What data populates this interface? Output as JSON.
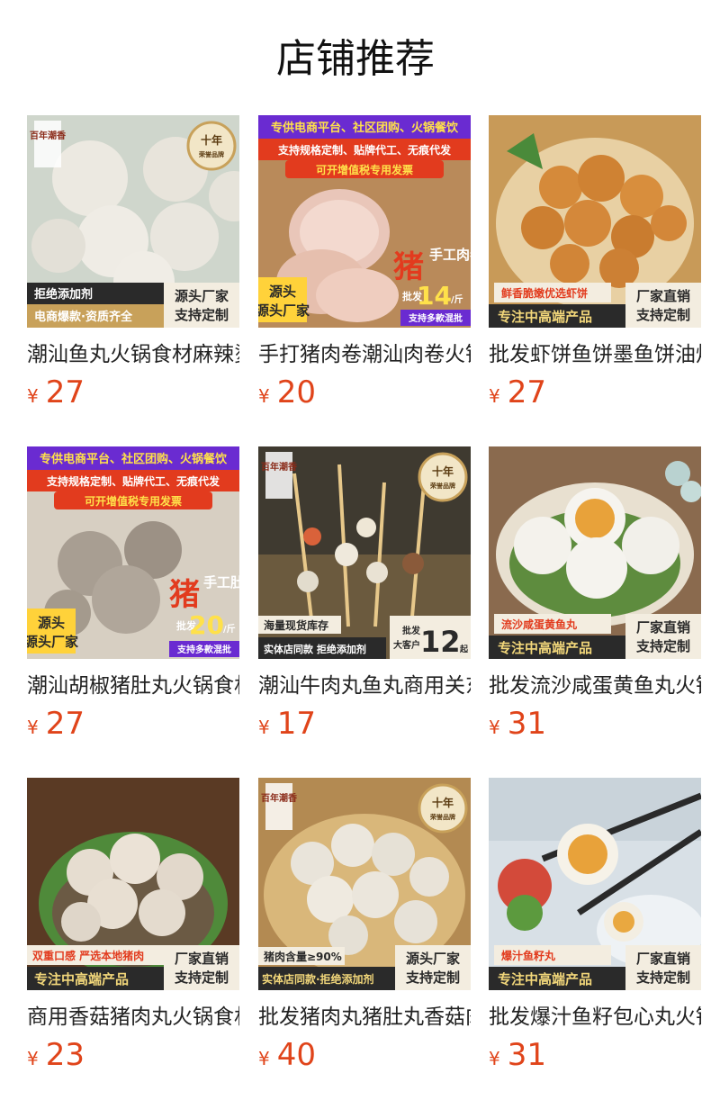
{
  "page": {
    "title": "店铺推荐",
    "currency_symbol": "¥"
  },
  "products": [
    {
      "name": "潮汕鱼丸火锅食材麻辣烫关东煮",
      "price": "27",
      "image_texts": {
        "top_seal": "十年",
        "seal_sub": "荣誉品牌",
        "brand": "百年潮香",
        "b1": "拒绝添加剂",
        "b2": "电商爆款·资质齐全",
        "b3": "源头厂家",
        "b4": "支持定制"
      }
    },
    {
      "name": "手打猪肉卷潮汕肉卷火锅食材",
      "price": "20",
      "image_texts": {
        "t1": "专供电商平台、社区团购、火锅餐饮",
        "t2": "支持规格定制、贴牌代工、无痕代发",
        "t3": "可开增值税专用发票",
        "big": "猪",
        "tag": "手工肉卷",
        "wh": "批发",
        "num": "14",
        "unit": "/斤",
        "src": "源头厂家",
        "foot": "支持多款混批"
      }
    },
    {
      "name": "批发虾饼鱼饼墨鱼饼油炸小吃",
      "price": "27",
      "image_texts": {
        "b1": "鲜香脆嫩优选虾饼",
        "b2": "专注中高端产品",
        "b3": "厂家直销",
        "b4": "支持定制"
      }
    },
    {
      "name": "潮汕胡椒猪肚丸火锅食材批发",
      "price": "27",
      "image_texts": {
        "t1": "专供电商平台、社区团购、火锅餐饮",
        "t2": "支持规格定制、贴牌代工、无痕代发",
        "t3": "可开增值税专用发票",
        "big": "猪",
        "tag": "手工肚丸",
        "wh": "批发",
        "num": "20",
        "unit": "/斤",
        "src": "源头厂家",
        "foot": "支持多款混批"
      }
    },
    {
      "name": "潮汕牛肉丸鱼丸商用关东煮串",
      "price": "17",
      "image_texts": {
        "top_seal": "十年",
        "seal_sub": "荣誉品牌",
        "brand": "百年潮香",
        "b1": "海量现货库存",
        "b2": "实体店同款 拒绝添加剂",
        "wh": "批发",
        "wh2": "大客户",
        "num": "12",
        "unit": "起"
      }
    },
    {
      "name": "批发流沙咸蛋黄鱼丸火锅丸子",
      "price": "31",
      "image_texts": {
        "b1": "流沙咸蛋黄鱼丸",
        "b2": "专注中高端产品",
        "b3": "厂家直销",
        "b4": "支持定制"
      }
    },
    {
      "name": "商用香菇猪肉丸火锅食材批发",
      "price": "23",
      "image_texts": {
        "b1": "双重口感 严选本地猪肉",
        "b2": "专注中高端产品",
        "b3": "厂家直销",
        "b4": "支持定制"
      }
    },
    {
      "name": "批发猪肉丸猪肚丸香菇肉丸子",
      "price": "40",
      "image_texts": {
        "top_seal": "十年",
        "seal_sub": "荣誉品牌",
        "brand": "百年潮香",
        "b1": "猪肉含量≥90%",
        "b2": "实体店同款·拒绝添加剂",
        "b3": "源头厂家",
        "b4": "支持定制"
      }
    },
    {
      "name": "批发爆汁鱼籽包心丸火锅食材",
      "price": "31",
      "image_texts": {
        "b1": "爆汁鱼籽丸",
        "b2": "专注中高端产品",
        "b3": "厂家直销",
        "b4": "支持定制"
      }
    }
  ],
  "colors": {
    "price": "#e0441a",
    "title": "#111111",
    "name": "#222222",
    "banner_gold": "#c8a15a",
    "banner_dark": "#2a2a2a",
    "banner_red": "#e23b1e",
    "banner_purple": "#6a2bd1"
  },
  "icons": [
    "seal-badge-icon",
    "brand-logo-icon"
  ]
}
